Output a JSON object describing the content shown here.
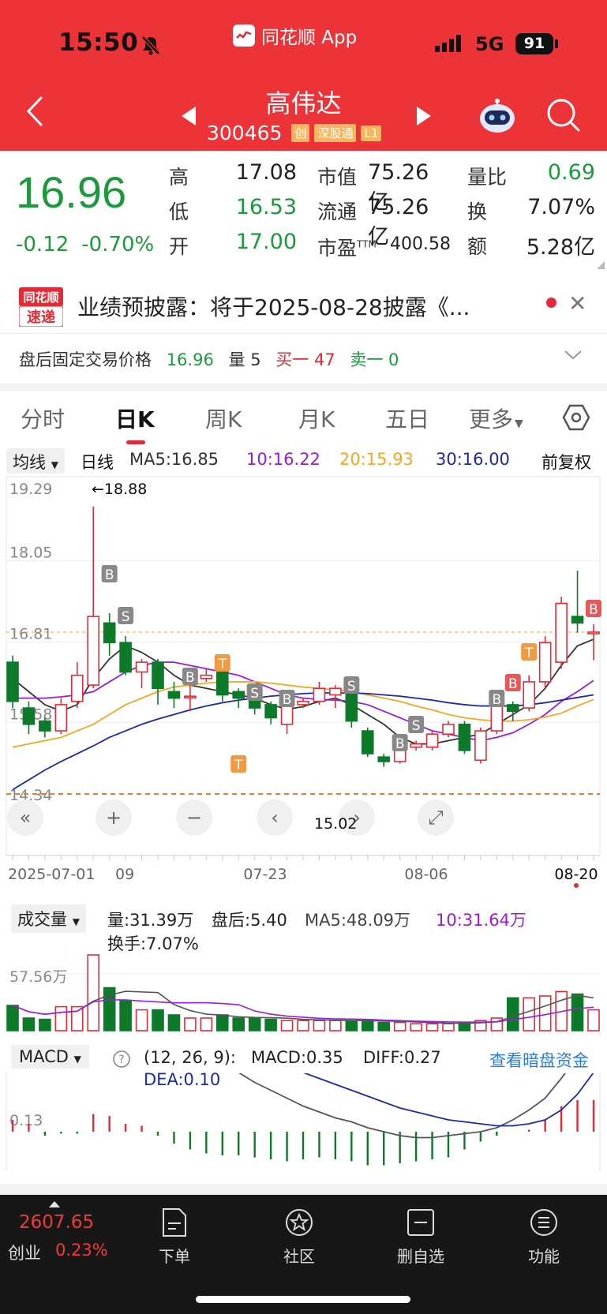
{
  "status": {
    "time": "15:50",
    "network": "5G",
    "battery": "91"
  },
  "app": {
    "name": "同花顺 App"
  },
  "stock": {
    "name": "高伟达",
    "code": "300465",
    "tags": [
      "创",
      "深股通",
      "L1"
    ]
  },
  "quote": {
    "price": "16.96",
    "change": "-0.12",
    "change_pct": "-0.70%",
    "high_label": "高",
    "high": "17.08",
    "low_label": "低",
    "low": "16.53",
    "open_label": "开",
    "open": "17.00",
    "mcap_label": "市值",
    "mcap": "75.26亿",
    "float_label": "流通",
    "float": "75.26亿",
    "pe_label": "市盈",
    "pe_sup": "TTM",
    "pe": "400.58",
    "vr_label": "量比",
    "vr": "0.69",
    "turn_label": "换",
    "turn": "7.07%",
    "amt_label": "额",
    "amt": "5.28亿"
  },
  "news": {
    "logo_top": "同花顺",
    "logo_bottom": "速递",
    "text": "业绩预披露：将于2025-08-28披露《..."
  },
  "afterhours": {
    "label": "盘后固定交易价格",
    "price": "16.96",
    "vol_label": "量",
    "vol": "5",
    "buy_label": "买一",
    "buy": "47",
    "sell_label": "卖一",
    "sell": "0"
  },
  "tabs": [
    "分时",
    "日K",
    "周K",
    "月K",
    "五日",
    "更多"
  ],
  "ma": {
    "select": "均线",
    "period": "日线",
    "ma5": "MA5:16.85",
    "ma10": "10:16.22",
    "ma20": "20:15.93",
    "ma30": "30:16.00",
    "adjust": "前复权",
    "colors": {
      "ma5": "#333333",
      "ma10": "#9b1bdb",
      "ma20": "#f5a623",
      "ma30": "#1c2aa8"
    }
  },
  "chart_data": [
    {
      "type": "candlestick",
      "y_ticks": [
        "19.29",
        "18.05",
        "16.81",
        "15.58",
        "14.34"
      ],
      "ylim": [
        14.34,
        19.29
      ],
      "x_labels": [
        "2025-07-01",
        "09",
        "07-23",
        "08-06",
        "08-20"
      ],
      "max_label": "←18.88",
      "current_price_line": 16.96,
      "candles": [
        {
          "o": 16.5,
          "c": 15.9,
          "h": 16.6,
          "l": 15.8
        },
        {
          "o": 15.8,
          "c": 15.55,
          "h": 15.9,
          "l": 15.4
        },
        {
          "o": 15.6,
          "c": 15.45,
          "h": 15.65,
          "l": 15.35
        },
        {
          "o": 15.45,
          "c": 15.85,
          "h": 15.95,
          "l": 15.4
        },
        {
          "o": 15.9,
          "c": 16.3,
          "h": 16.5,
          "l": 15.8
        },
        {
          "o": 16.15,
          "c": 17.2,
          "h": 18.88,
          "l": 16.1
        },
        {
          "o": 17.1,
          "c": 16.8,
          "h": 17.25,
          "l": 16.6
        },
        {
          "o": 16.8,
          "c": 16.35,
          "h": 16.9,
          "l": 16.3
        },
        {
          "o": 16.35,
          "c": 16.5,
          "h": 16.55,
          "l": 16.1
        },
        {
          "o": 16.5,
          "c": 16.1,
          "h": 16.55,
          "l": 15.85
        },
        {
          "o": 16.05,
          "c": 15.95,
          "h": 16.2,
          "l": 15.8
        },
        {
          "o": 15.98,
          "c": 15.98,
          "h": 16.25,
          "l": 15.75
        },
        {
          "o": 16.25,
          "c": 16.3,
          "h": 16.4,
          "l": 16.2
        },
        {
          "o": 16.35,
          "c": 16.0,
          "h": 16.4,
          "l": 15.9
        },
        {
          "o": 16.05,
          "c": 15.95,
          "h": 16.1,
          "l": 15.8
        },
        {
          "o": 15.98,
          "c": 15.8,
          "h": 16.0,
          "l": 15.7
        },
        {
          "o": 15.85,
          "c": 15.65,
          "h": 15.9,
          "l": 15.55
        },
        {
          "o": 15.55,
          "c": 15.9,
          "h": 15.95,
          "l": 15.4
        },
        {
          "o": 15.85,
          "c": 15.9,
          "h": 15.95,
          "l": 15.8
        },
        {
          "o": 15.9,
          "c": 16.1,
          "h": 16.2,
          "l": 15.85
        },
        {
          "o": 16.0,
          "c": 16.1,
          "h": 16.15,
          "l": 15.8
        },
        {
          "o": 16.05,
          "c": 15.6,
          "h": 16.1,
          "l": 15.5
        },
        {
          "o": 15.45,
          "c": 15.1,
          "h": 15.5,
          "l": 15.05
        },
        {
          "o": 15.05,
          "c": 14.98,
          "h": 15.1,
          "l": 14.9
        },
        {
          "o": 14.98,
          "c": 15.2,
          "h": 15.25,
          "l": 14.95
        },
        {
          "o": 15.2,
          "c": 15.25,
          "h": 15.3,
          "l": 15.15
        },
        {
          "o": 15.2,
          "c": 15.4,
          "h": 15.45,
          "l": 15.15
        },
        {
          "o": 15.4,
          "c": 15.55,
          "h": 15.6,
          "l": 15.35
        },
        {
          "o": 15.55,
          "c": 15.15,
          "h": 15.6,
          "l": 15.1
        },
        {
          "o": 15.0,
          "c": 15.45,
          "h": 15.5,
          "l": 14.95
        },
        {
          "o": 15.45,
          "c": 15.85,
          "h": 15.9,
          "l": 15.4
        },
        {
          "o": 15.85,
          "c": 15.75,
          "h": 15.9,
          "l": 15.6
        },
        {
          "o": 15.8,
          "c": 16.2,
          "h": 16.3,
          "l": 15.75
        },
        {
          "o": 16.2,
          "c": 16.8,
          "h": 16.9,
          "l": 16.1
        },
        {
          "o": 16.5,
          "c": 17.4,
          "h": 17.5,
          "l": 16.4
        },
        {
          "o": 17.2,
          "c": 17.1,
          "h": 17.9,
          "l": 16.95
        },
        {
          "o": 16.96,
          "c": 16.96,
          "h": 17.08,
          "l": 16.53
        }
      ],
      "series": [
        {
          "name": "MA5",
          "values": [
            16.25,
            16.05,
            15.85,
            15.75,
            15.85,
            16.25,
            16.55,
            16.75,
            16.65,
            16.5,
            16.3,
            16.15,
            16.1,
            16.05,
            16.0,
            15.95,
            15.85,
            15.78,
            15.82,
            15.9,
            15.95,
            15.85,
            15.7,
            15.55,
            15.35,
            15.25,
            15.25,
            15.3,
            15.35,
            15.4,
            15.55,
            15.7,
            15.85,
            16.1,
            16.45,
            16.75,
            16.85
          ]
        },
        {
          "name": "10",
          "values": [
            15.95,
            15.95,
            15.95,
            15.97,
            16.0,
            16.05,
            16.2,
            16.35,
            16.45,
            16.5,
            16.5,
            16.45,
            16.4,
            16.35,
            16.3,
            16.2,
            16.1,
            16.0,
            15.95,
            15.93,
            15.92,
            15.9,
            15.85,
            15.75,
            15.65,
            15.55,
            15.45,
            15.4,
            15.35,
            15.3,
            15.35,
            15.42,
            15.55,
            15.7,
            15.9,
            16.05,
            16.22
          ]
        },
        {
          "name": "20",
          "values": [
            15.2,
            15.25,
            15.3,
            15.35,
            15.45,
            15.55,
            15.7,
            15.85,
            15.95,
            16.05,
            16.12,
            16.15,
            16.18,
            16.2,
            16.2,
            16.2,
            16.18,
            16.15,
            16.12,
            16.1,
            16.08,
            16.05,
            16.0,
            15.95,
            15.9,
            15.83,
            15.77,
            15.7,
            15.65,
            15.62,
            15.6,
            15.6,
            15.62,
            15.66,
            15.72,
            15.83,
            15.93
          ]
        },
        {
          "name": "30",
          "values": [
            14.55,
            14.7,
            14.85,
            14.98,
            15.1,
            15.22,
            15.35,
            15.45,
            15.55,
            15.63,
            15.7,
            15.77,
            15.83,
            15.88,
            15.92,
            15.95,
            15.98,
            16.0,
            16.02,
            16.03,
            16.03,
            16.03,
            16.02,
            16.0,
            15.98,
            15.95,
            15.92,
            15.88,
            15.85,
            15.83,
            15.83,
            15.83,
            15.85,
            15.88,
            15.92,
            15.96,
            16.0
          ]
        }
      ]
    },
    {
      "type": "bar",
      "name": "成交量",
      "y_tick": "57.56万",
      "values": [
        40,
        20,
        18,
        38,
        38,
        120,
        68,
        48,
        33,
        33,
        25,
        20,
        20,
        25,
        20,
        20,
        18,
        16,
        16,
        16,
        16,
        16,
        16,
        13,
        13,
        11,
        11,
        11,
        13,
        16,
        20,
        52,
        52,
        55,
        62,
        58,
        33
      ]
    },
    {
      "type": "bar",
      "name": "MACD",
      "y_tick": "0.13",
      "values": [
        0.06,
        0.04,
        -0.02,
        -0.01,
        -0.01,
        0.09,
        0.08,
        0.04,
        0.03,
        -0.02,
        -0.06,
        -0.09,
        -0.11,
        -0.12,
        -0.12,
        -0.13,
        -0.14,
        -0.15,
        -0.14,
        -0.13,
        -0.14,
        -0.15,
        -0.17,
        -0.17,
        -0.16,
        -0.15,
        -0.14,
        -0.13,
        -0.09,
        -0.05,
        -0.02,
        0.0,
        0.01,
        0.06,
        0.13,
        0.16,
        0.16
      ],
      "series": [
        {
          "name": "DIFF",
          "values": [
            0.35,
            0.32,
            0.3,
            0.28,
            0.3,
            0.38,
            0.42,
            0.41,
            0.38,
            0.33,
            0.28,
            0.24,
            0.19,
            0.14,
            0.1,
            0.05,
            0.01,
            -0.03,
            -0.07,
            -0.1,
            -0.13,
            -0.15,
            -0.18,
            -0.2,
            -0.22,
            -0.23,
            -0.23,
            -0.22,
            -0.21,
            -0.2,
            -0.18,
            -0.14,
            -0.09,
            -0.03,
            0.07,
            0.18,
            0.27
          ]
        },
        {
          "name": "DEA",
          "values": [
            0.32,
            0.31,
            0.3,
            0.29,
            0.29,
            0.31,
            0.33,
            0.34,
            0.34,
            0.34,
            0.33,
            0.31,
            0.29,
            0.26,
            0.23,
            0.2,
            0.17,
            0.14,
            0.1,
            0.07,
            0.04,
            0.01,
            -0.02,
            -0.05,
            -0.08,
            -0.1,
            -0.12,
            -0.14,
            -0.15,
            -0.16,
            -0.17,
            -0.17,
            -0.16,
            -0.14,
            -0.09,
            -0.01,
            0.1
          ]
        }
      ]
    }
  ],
  "chart_markers": {
    "b_label": "B",
    "s_label": "S",
    "t_label": "T",
    "current_overlay": "15.02"
  },
  "volume": {
    "select": "成交量",
    "vol": "量:31.39万",
    "after": "盘后:5.40",
    "ma5": "MA5:48.09万",
    "ma10": "10:31.64万",
    "turnover": "换手:7.07%"
  },
  "macd": {
    "select": "MACD",
    "params": "(12, 26, 9):",
    "macd": "MACD:0.35",
    "diff": "DIFF:0.27",
    "dea": "DEA:0.10",
    "link": "查看暗盘资金"
  },
  "bottom_nav": {
    "index_value": "2607.65",
    "index_name": "创业",
    "index_pct": "0.23%",
    "items": [
      "下单",
      "社区",
      "删自选",
      "功能"
    ]
  }
}
